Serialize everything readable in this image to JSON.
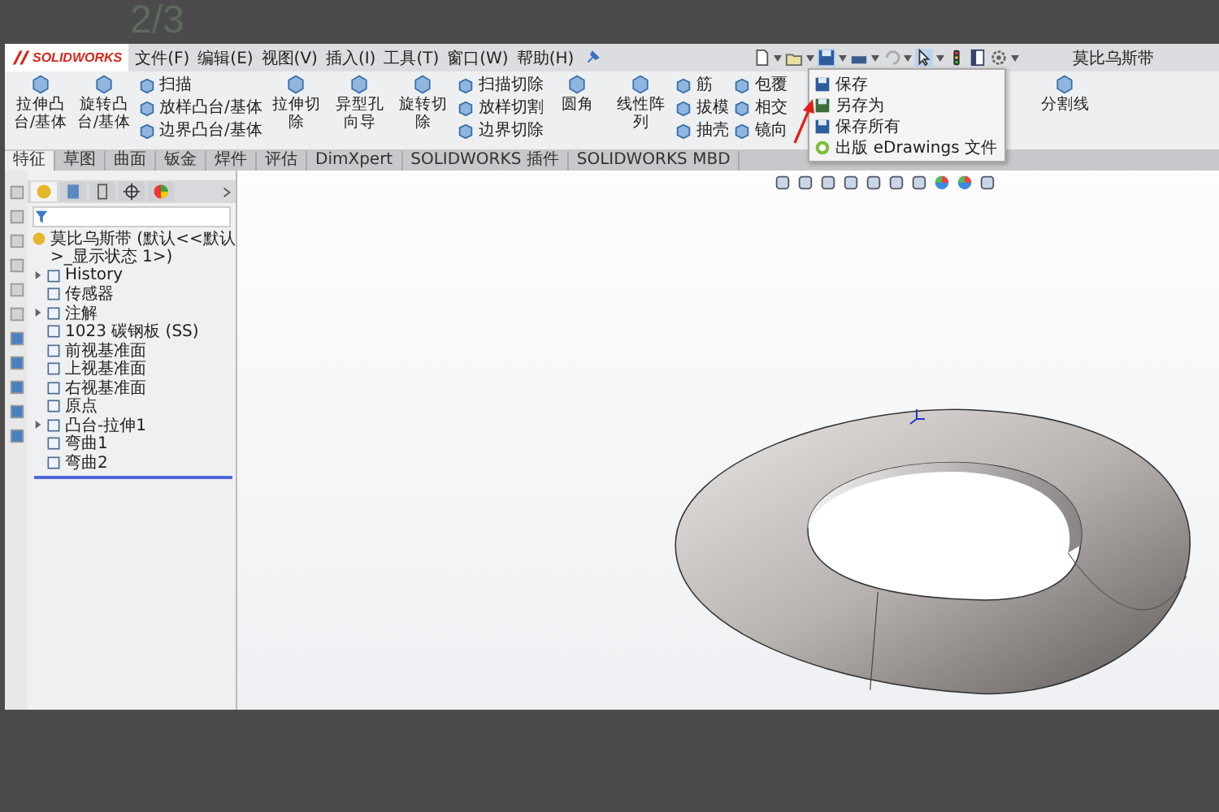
{
  "page_counter": "2/3",
  "menubar": {
    "logo": "SOLIDWORKS",
    "menus": [
      "文件(F)",
      "编辑(E)",
      "视图(V)",
      "插入(I)",
      "工具(T)",
      "窗口(W)",
      "帮助(H)"
    ],
    "title": "莫比乌斯带"
  },
  "save_menu": {
    "items": [
      {
        "label": "保存"
      },
      {
        "label": "另存为"
      },
      {
        "label": "保存所有"
      },
      {
        "label": "出版 eDrawings 文件"
      }
    ]
  },
  "ribbon": {
    "columns": [
      {
        "kind": "large",
        "label": "拉伸凸台/基体"
      },
      {
        "kind": "large",
        "label": "旋转凸台/基体"
      },
      {
        "kind": "stack",
        "items": [
          "扫描",
          "放样凸台/基体",
          "边界凸台/基体"
        ]
      },
      {
        "kind": "large",
        "label": "拉伸切除"
      },
      {
        "kind": "large",
        "label": "异型孔向导"
      },
      {
        "kind": "large",
        "label": "旋转切除"
      },
      {
        "kind": "stack",
        "items": [
          "扫描切除",
          "放样切割",
          "边界切除"
        ]
      },
      {
        "kind": "large",
        "label": "圆角"
      },
      {
        "kind": "large",
        "label": "线性阵列"
      },
      {
        "kind": "stack",
        "items": [
          "筋",
          "拔模",
          "抽壳"
        ]
      },
      {
        "kind": "stack",
        "items": [
          "包覆",
          "相交",
          "镜向"
        ]
      },
      {
        "kind": "large",
        "label": "分割线"
      }
    ]
  },
  "tabs": [
    {
      "label": "特征",
      "selected": true
    },
    {
      "label": "草图",
      "selected": false
    },
    {
      "label": "曲面",
      "selected": false
    },
    {
      "label": "钣金",
      "selected": false
    },
    {
      "label": "焊件",
      "selected": false
    },
    {
      "label": "评估",
      "selected": false
    },
    {
      "label": "DimXpert",
      "selected": false
    },
    {
      "label": "SOLIDWORKS 插件",
      "selected": false
    },
    {
      "label": "SOLIDWORKS MBD",
      "selected": false
    }
  ],
  "tree": {
    "root": "莫比乌斯带 (默认<<默认>_显示状态 1>)",
    "items": [
      {
        "label": "History",
        "expandable": true
      },
      {
        "label": "传感器",
        "expandable": false
      },
      {
        "label": "注解",
        "expandable": true
      },
      {
        "label": "1023 碳钢板 (SS)",
        "expandable": false
      },
      {
        "label": "前视基准面",
        "expandable": false
      },
      {
        "label": "上视基准面",
        "expandable": false
      },
      {
        "label": "右视基准面",
        "expandable": false
      },
      {
        "label": "原点",
        "expandable": false
      },
      {
        "label": "凸台-拉伸1",
        "expandable": true
      },
      {
        "label": "弯曲1",
        "expandable": false
      },
      {
        "label": "弯曲2",
        "expandable": false
      }
    ]
  }
}
